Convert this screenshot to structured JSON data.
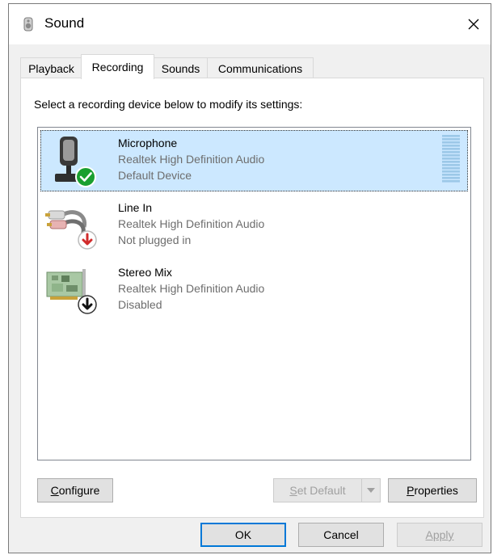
{
  "window": {
    "title": "Sound",
    "app_icon": "speaker-icon",
    "close_icon": "close-icon"
  },
  "tabs": [
    {
      "label": "Playback",
      "active": false
    },
    {
      "label": "Recording",
      "active": true
    },
    {
      "label": "Sounds",
      "active": false
    },
    {
      "label": "Communications",
      "active": false
    }
  ],
  "panel": {
    "instruction": "Select a recording device below to modify its settings:"
  },
  "devices": [
    {
      "name": "Microphone",
      "driver": "Realtek High Definition Audio",
      "status": "Default Device",
      "icon": "microphone-icon",
      "badge": "green-check-icon",
      "selected": true
    },
    {
      "name": "Line In",
      "driver": "Realtek High Definition Audio",
      "status": "Not plugged in",
      "icon": "audio-cable-icon",
      "badge": "red-down-arrow-icon",
      "selected": false
    },
    {
      "name": "Stereo Mix",
      "driver": "Realtek High Definition Audio",
      "status": "Disabled",
      "icon": "sound-card-icon",
      "badge": "black-down-arrow-icon",
      "selected": false
    }
  ],
  "actions": {
    "configure": {
      "before": "",
      "accel": "C",
      "after": "onfigure"
    },
    "set_default": {
      "before": "",
      "accel": "S",
      "after": "et Default",
      "enabled": false
    },
    "properties": {
      "before": "",
      "accel": "P",
      "after": "roperties"
    }
  },
  "footer": {
    "ok": "OK",
    "cancel": "Cancel",
    "apply": "Apply",
    "apply_enabled": false
  },
  "colors": {
    "selection": "#cce8ff",
    "accent": "#0078d7",
    "check": "#1a9f2f",
    "warn": "#d12b2b"
  }
}
